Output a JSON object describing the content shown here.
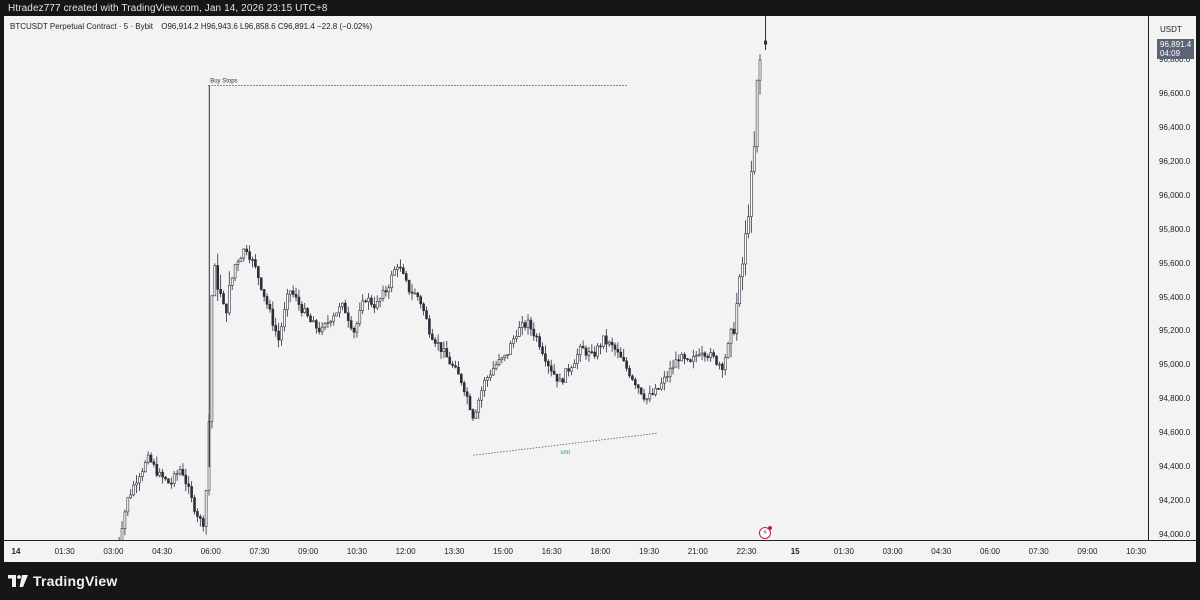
{
  "header": {
    "attribution": "Htradez777 created with TradingView.com, Jan 14, 2026 23:15 UTC+8"
  },
  "legend": {
    "symbol": "BTCUSDT Perpetual Contract · 5 · Bybit",
    "open": "O96,914.2",
    "high": "H96,943.6",
    "low": "L96,858.6",
    "close": "C96,891.4",
    "change": "−22.8 (−0.02%)"
  },
  "price_axis": {
    "currency": "USDT",
    "last_price": "96,891.4",
    "countdown": "04:09",
    "ticks": [
      "96,800.0",
      "96,600.0",
      "96,400.0",
      "96,200.0",
      "96,000.0",
      "95,800.0",
      "95,600.0",
      "95,400.0",
      "95,200.0",
      "95,000.0",
      "94,800.0",
      "94,600.0",
      "94,400.0",
      "94,200.0",
      "94,000.0"
    ]
  },
  "time_axis": {
    "ticks": [
      "14",
      "01:30",
      "03:00",
      "04:30",
      "06:00",
      "07:30",
      "09:00",
      "10:30",
      "12:00",
      "13:30",
      "15:00",
      "16:30",
      "18:00",
      "19:30",
      "21:00",
      "22:30",
      "15",
      "01:30",
      "03:00",
      "04:30",
      "06:00",
      "07:30",
      "09:00",
      "10:30"
    ],
    "bold_ticks": [
      "14",
      "15"
    ]
  },
  "annotations": {
    "buy_stops_label": "Buy Stops",
    "smt_label": "smt"
  },
  "colors": {
    "candle": "#2a2e39",
    "annotation_line": "#555555",
    "smt_text": "#1e9e7a",
    "price_tag_bg": "#5b6375",
    "background": "#f3f3f3",
    "frame": "#161616"
  },
  "footer": {
    "brand": "TradingView",
    "logo_icon": "tradingview-logo-icon"
  },
  "chart_data": {
    "type": "candlestick",
    "symbol": "BTCUSDT",
    "timeframe": "5",
    "ylim": [
      94000,
      96950
    ],
    "levels": [
      {
        "label": "Buy Stops",
        "price": 96650,
        "from": "06:10",
        "to": "19:05"
      },
      {
        "label": "smt",
        "from_price": 94470,
        "to_price": 94600,
        "from": "14:20",
        "to": "20:00"
      }
    ],
    "swing_path": [
      [
        "03:20",
        93900
      ],
      [
        "03:40",
        94200
      ],
      [
        "04:00",
        94350
      ],
      [
        "04:20",
        94450
      ],
      [
        "04:40",
        94350
      ],
      [
        "05:00",
        94300
      ],
      [
        "05:20",
        94400
      ],
      [
        "05:40",
        94200
      ],
      [
        "06:00",
        94050
      ],
      [
        "06:10",
        94400
      ],
      [
        "06:15",
        95300
      ],
      [
        "06:20",
        95600
      ],
      [
        "06:40",
        95300
      ],
      [
        "07:00",
        95600
      ],
      [
        "07:20",
        95700
      ],
      [
        "07:40",
        95550
      ],
      [
        "08:00",
        95350
      ],
      [
        "08:20",
        95150
      ],
      [
        "08:40",
        95450
      ],
      [
        "09:00",
        95350
      ],
      [
        "09:20",
        95250
      ],
      [
        "09:40",
        95200
      ],
      [
        "10:00",
        95300
      ],
      [
        "10:20",
        95350
      ],
      [
        "10:40",
        95200
      ],
      [
        "11:00",
        95400
      ],
      [
        "11:20",
        95350
      ],
      [
        "11:40",
        95450
      ],
      [
        "12:00",
        95600
      ],
      [
        "12:20",
        95450
      ],
      [
        "12:40",
        95400
      ],
      [
        "13:00",
        95200
      ],
      [
        "13:20",
        95100
      ],
      [
        "13:40",
        95000
      ],
      [
        "14:00",
        94900
      ],
      [
        "14:20",
        94700
      ],
      [
        "14:40",
        94900
      ],
      [
        "15:00",
        95000
      ],
      [
        "15:20",
        95050
      ],
      [
        "15:40",
        95200
      ],
      [
        "16:00",
        95250
      ],
      [
        "16:20",
        95150
      ],
      [
        "16:40",
        95000
      ],
      [
        "17:00",
        94900
      ],
      [
        "17:20",
        95000
      ],
      [
        "17:40",
        95100
      ],
      [
        "18:00",
        95050
      ],
      [
        "18:20",
        95150
      ],
      [
        "18:40",
        95100
      ],
      [
        "19:00",
        95000
      ],
      [
        "19:20",
        94900
      ],
      [
        "19:40",
        94800
      ],
      [
        "20:00",
        94850
      ],
      [
        "20:20",
        94950
      ],
      [
        "20:40",
        95050
      ],
      [
        "21:00",
        95000
      ],
      [
        "21:20",
        95100
      ],
      [
        "21:40",
        95050
      ],
      [
        "22:00",
        95000
      ],
      [
        "22:20",
        95200
      ],
      [
        "22:40",
        95650
      ],
      [
        "23:00",
        96300
      ],
      [
        "23:05",
        96700
      ],
      [
        "23:15",
        96891.4
      ]
    ],
    "last": {
      "open": 96914.2,
      "high": 96943.6,
      "low": 96858.6,
      "close": 96891.4
    }
  }
}
